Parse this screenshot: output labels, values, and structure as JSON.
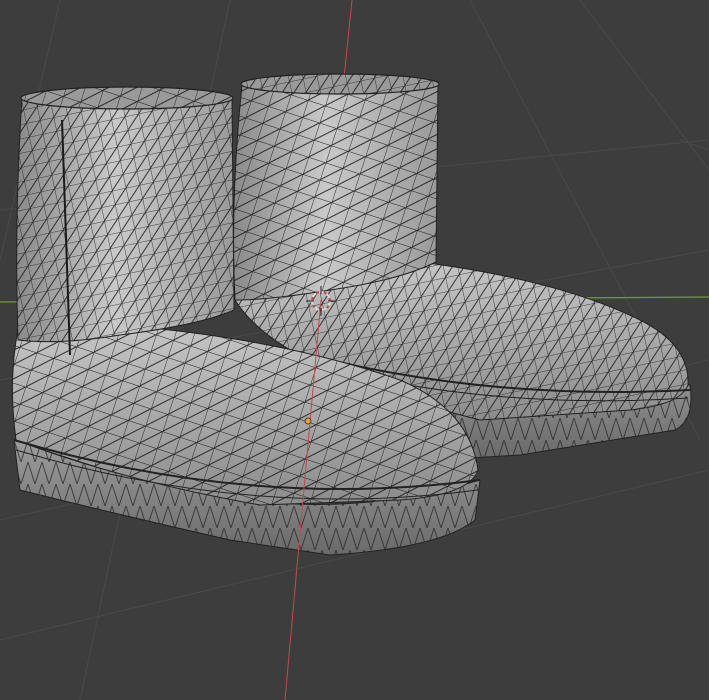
{
  "viewport": {
    "background_color": "#3d3d3d",
    "grid_color": "#4a4a4a",
    "x_axis_color": "#6f9a3a",
    "y_axis_color": "#c4484f",
    "mesh_fill_color": "#b4b4b4",
    "mesh_shade_color": "#8e8e8e",
    "wire_color": "#111111",
    "origin_dot_color": "#f0a030"
  },
  "objects": [
    {
      "name": "left-boot",
      "icon": "mesh-object-icon"
    },
    {
      "name": "right-boot",
      "icon": "mesh-object-icon"
    }
  ],
  "gizmos": [
    {
      "name": "3d-cursor",
      "icon": "crosshair-icon"
    },
    {
      "name": "object-origin",
      "icon": "dot-icon"
    }
  ]
}
